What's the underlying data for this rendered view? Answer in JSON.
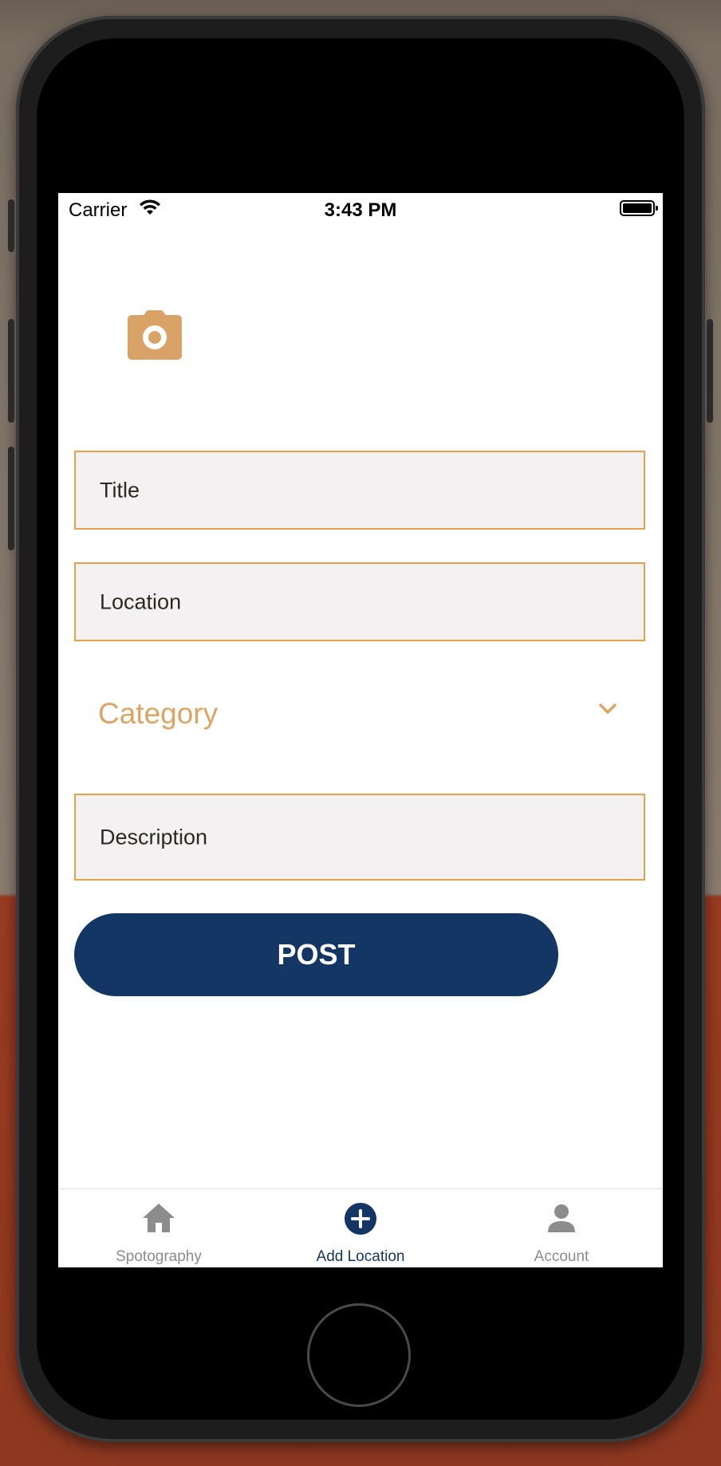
{
  "status_bar": {
    "carrier": "Carrier",
    "time": "3:43 PM"
  },
  "form": {
    "title_label": "Title",
    "location_label": "Location",
    "category_label": "Category",
    "description_label": "Description",
    "post_label": "POST"
  },
  "tabs": [
    {
      "label": "Spotography",
      "icon": "home-icon",
      "active": false
    },
    {
      "label": "Add Location",
      "icon": "plus-circle-icon",
      "active": true
    },
    {
      "label": "Account",
      "icon": "person-icon",
      "active": false
    }
  ],
  "colors": {
    "accent": "#e8a04a",
    "category_text": "#dba565",
    "primary": "#143665",
    "field_bg": "#f3f1f1",
    "inactive_tab": "#8c8c8c"
  }
}
